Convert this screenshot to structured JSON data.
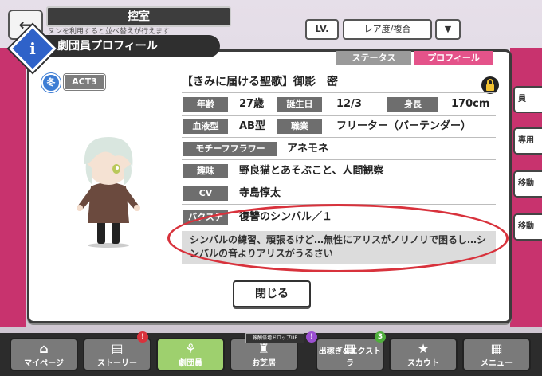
{
  "topbar": {
    "back_icon": "arrow-left-icon",
    "room_title": "控室",
    "room_hint": "ヌンを利用すると並べ替えが行えます",
    "lv_label": "LV.",
    "sort_label": "レア度/複合",
    "sort_toggle_icon": "triangle-down-icon"
  },
  "side_buttons": [
    "員",
    "専用",
    "移動",
    "移動"
  ],
  "modal": {
    "title": "劇団員プロフィール",
    "tabs": [
      {
        "label": "ステータス",
        "active": false
      },
      {
        "label": "プロフィール",
        "active": true
      }
    ],
    "season": "冬",
    "act": "ACT3",
    "card_title": "【きみに届ける聖歌】御影　密",
    "profile": {
      "age_label": "年齢",
      "age": "27歳",
      "birthday_label": "誕生日",
      "birthday": "12/3",
      "height_label": "身長",
      "height": "170cm",
      "blood_label": "血液型",
      "blood": "AB型",
      "job_label": "職業",
      "job": "フリーター（バーテンダー）",
      "flower_label": "モチーフフラワー",
      "flower": "アネモネ",
      "hobby_label": "趣味",
      "hobby": "野良猫とあそぶこと、人間観察",
      "cv_label": "CV",
      "cv": "寺島惇太",
      "backstage_label": "バクステ",
      "backstage": "復讐のシンバル／１"
    },
    "quote": "シンバルの練習、頑張るけど…無性にアリスがノリノリで困るし…シンバルの音よりアリスがうるさい",
    "close_label": "閉じる",
    "accent": "#e4538a",
    "highlight_color": "#d8323c"
  },
  "bottom_nav": {
    "drop_label": "報酬倍増ドロップUP",
    "items": [
      {
        "label": "マイページ",
        "icon": "home-icon",
        "active": false,
        "badge": ""
      },
      {
        "label": "ストーリー",
        "icon": "book-icon",
        "active": false,
        "badge": "!"
      },
      {
        "label": "劇団員",
        "icon": "ribbon-icon",
        "active": true,
        "badge": ""
      },
      {
        "label": "お芝居",
        "icon": "theater-icon",
        "active": false,
        "badge": "!"
      },
      {
        "label": "出稼ぎ&エクストラ",
        "icon": "shop-icon",
        "active": false,
        "badge": "3"
      },
      {
        "label": "スカウト",
        "icon": "star-icon",
        "active": false,
        "badge": ""
      },
      {
        "label": "メニュー",
        "icon": "grid-icon",
        "active": false,
        "badge": ""
      }
    ]
  }
}
